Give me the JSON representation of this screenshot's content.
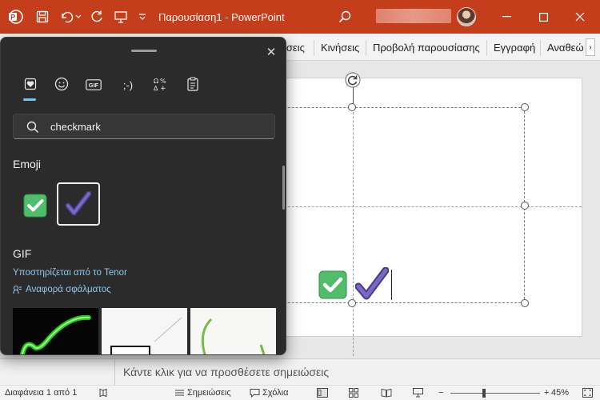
{
  "titlebar": {
    "doc_title": "Παρουσίαση1 - PowerPoint",
    "accent_color": "#c43e1c"
  },
  "ribbon": {
    "tabs": [
      "ίσεις",
      "Κινήσεις",
      "Προβολή παρουσίασης",
      "Εγγραφή",
      "Αναθεώ"
    ],
    "scroll_label": "›"
  },
  "emoji_panel": {
    "close_label": "✕",
    "tabs": [
      "recent-icon",
      "emoji-icon",
      "gif-icon",
      "kaomoji-icon",
      "symbols-icon",
      "clipboard-icon"
    ],
    "gif_tab_label": "GIF",
    "kaomoji_tab_label": ";-)",
    "search": {
      "value": "checkmark"
    },
    "emoji_section": "Emoji",
    "emoji_results": [
      "✅",
      "✔️"
    ],
    "gif_section": "GIF",
    "tenor_text": "Υποστηρίζεται από το Tenor",
    "report_text": "Αναφορά σφάλματος"
  },
  "slide": {
    "content": [
      "✅",
      "✔️"
    ]
  },
  "notes": {
    "placeholder": "Κάντε κλικ για να προσθέσετε σημειώσεις"
  },
  "statusbar": {
    "slide_info": "Διαφάνεια 1 από 1",
    "notes_label": "Σημειώσεις",
    "comments_label": "Σχόλια",
    "zoom_minus": "−",
    "zoom_plus": "+",
    "zoom": "45%"
  }
}
